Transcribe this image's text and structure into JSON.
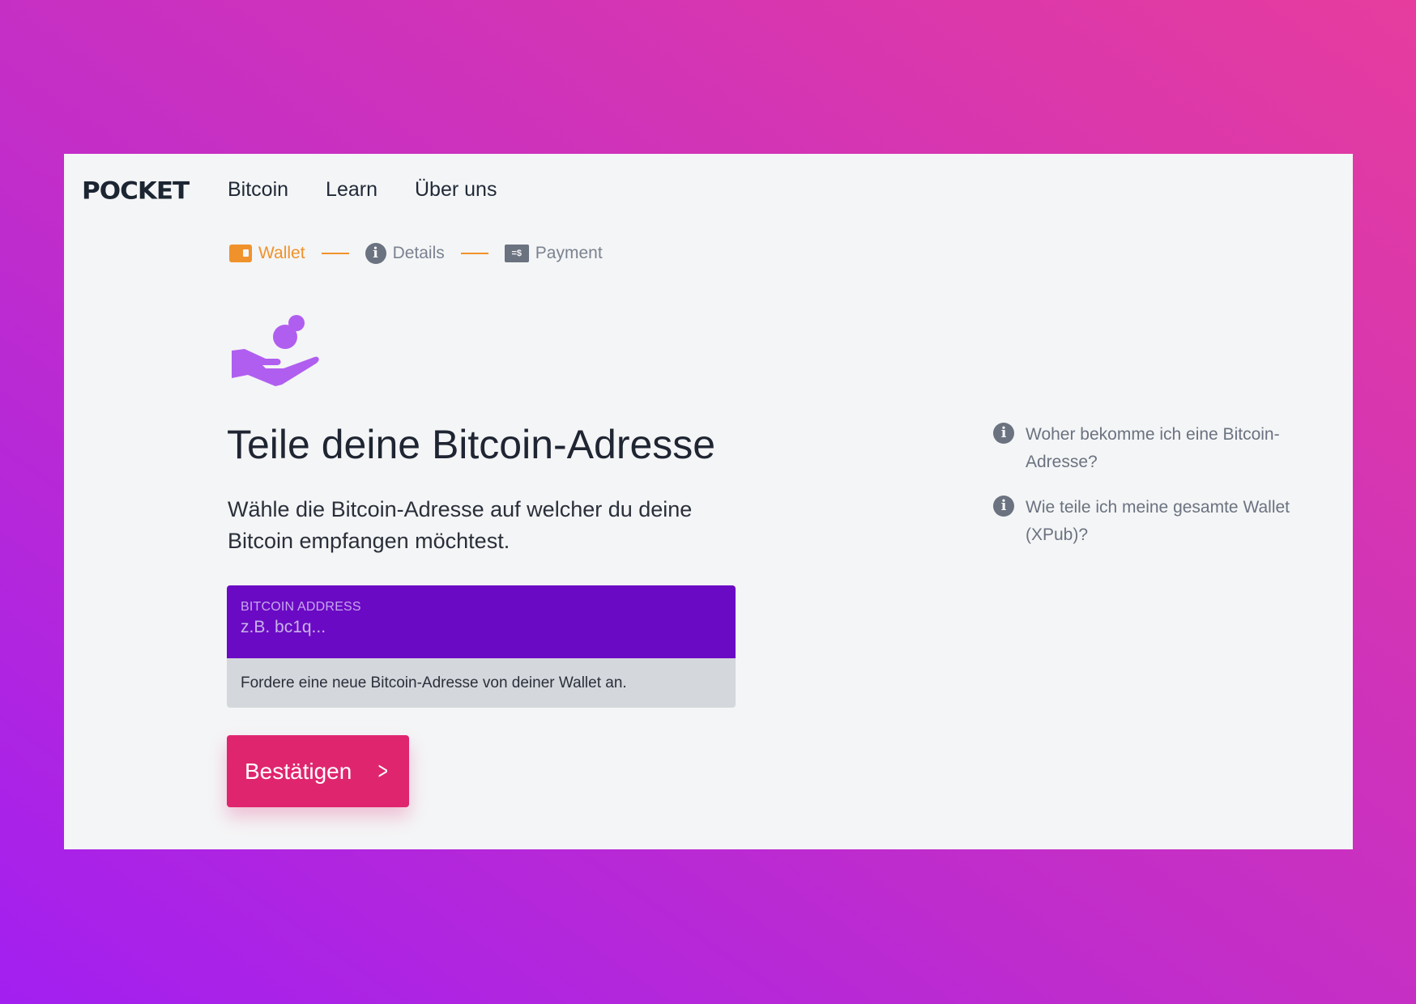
{
  "header": {
    "logo": "POCKET",
    "nav": [
      "Bitcoin",
      "Learn",
      "Über uns"
    ]
  },
  "steps": [
    {
      "label": "Wallet",
      "icon": "wallet-icon",
      "state": "active"
    },
    {
      "label": "Details",
      "icon": "info-icon",
      "state": "pending"
    },
    {
      "label": "Payment",
      "icon": "payment-check-icon",
      "state": "pending"
    }
  ],
  "main": {
    "hero_icon": "hand-receiving-coin-icon",
    "title": "Teile deine Bitcoin-Adresse",
    "subtitle": "Wähle die Bitcoin-Adresse auf welcher du deine Bitcoin empfangen möchtest.",
    "address_field": {
      "label": "BITCOIN ADDRESS",
      "placeholder": "z.B. bc1q...",
      "value": ""
    },
    "hint": "Fordere eine neue Bitcoin-Adresse von deiner Wallet an.",
    "confirm_button": "Bestätigen"
  },
  "help": [
    {
      "text": "Woher bekomme ich eine Bitcoin-Adresse?"
    },
    {
      "text": "Wie teile ich meine gesamte Wallet (XPub)?"
    }
  ],
  "colors": {
    "accent": "#6b0ac4",
    "button": "#e0256f",
    "step_active": "#f0922b",
    "icon_purple": "#b05ef0"
  }
}
